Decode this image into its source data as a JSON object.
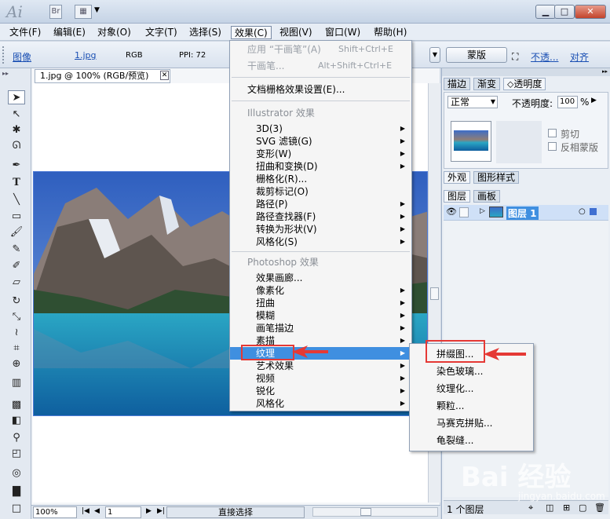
{
  "titlebar": {
    "app_logo": "Ai",
    "bridge_icon": "Br",
    "window_buttons": [
      "▁",
      "□",
      "✕"
    ]
  },
  "menubar": [
    {
      "label": "文件(F)"
    },
    {
      "label": "编辑(E)"
    },
    {
      "label": "对象(O)"
    },
    {
      "label": "文字(T)"
    },
    {
      "label": "选择(S)"
    },
    {
      "label": "效果(C)"
    },
    {
      "label": "视图(V)"
    },
    {
      "label": "窗口(W)"
    },
    {
      "label": "帮助(H)"
    }
  ],
  "control_bar": {
    "image_link": "图像",
    "file_link": "1.jpg",
    "color_mode": "RGB",
    "ppi": "PPI: 72",
    "mask_button": "蒙版",
    "opacity_link": "不透...",
    "align_link": "对齐"
  },
  "document": {
    "tab_title": "1.jpg @ 100% (RGB/预览)",
    "zoom": "100%",
    "page": "1",
    "status_tool": "直接选择"
  },
  "effect_menu": {
    "apply_last": {
      "label": "应用 “干画笔”(A)",
      "shortcut": "Shift+Ctrl+E"
    },
    "last_effect": {
      "label": "干画笔...",
      "shortcut": "Alt+Shift+Ctrl+E"
    },
    "doc_raster": "文档栅格效果设置(E)...",
    "illustrator_section": "Illustrator 效果",
    "illustrator_items": [
      "3D(3)",
      "SVG 滤镜(G)",
      "变形(W)",
      "扭曲和变换(D)",
      "栅格化(R)...",
      "裁剪标记(O)",
      "路径(P)",
      "路径查找器(F)",
      "转换为形状(V)",
      "风格化(S)"
    ],
    "photoshop_section": "Photoshop 效果",
    "photoshop_items": [
      "效果画廊...",
      "像素化",
      "扭曲",
      "模糊",
      "画笔描边",
      "素描",
      "纹理",
      "艺术效果",
      "视频",
      "锐化",
      "风格化"
    ]
  },
  "texture_menu": [
    "拼缀图...",
    "染色玻璃...",
    "纹理化...",
    "颗粒...",
    "马赛克拼贴...",
    "龟裂缝..."
  ],
  "right_panels": {
    "top_tabs": [
      "描边",
      "渐变",
      "透明度"
    ],
    "blend_mode": "正常",
    "opacity_label": "不透明度:",
    "opacity_value": "100",
    "opacity_unit": "%",
    "clip_label": "剪切",
    "invert_mask_label": "反相蒙版",
    "appearance_tabs": [
      "外观",
      "图形样式"
    ],
    "layer_tabs": [
      "图层",
      "画板"
    ],
    "layer_name": "图层 1",
    "layer_count": "1 个图层"
  },
  "watermark": {
    "text": "Bai 经验",
    "url": "jingyan.baidu.com"
  },
  "colors": {
    "highlight": "#3f8fe0",
    "annotation_red": "#e53935",
    "link_blue": "#1a4fb3"
  }
}
